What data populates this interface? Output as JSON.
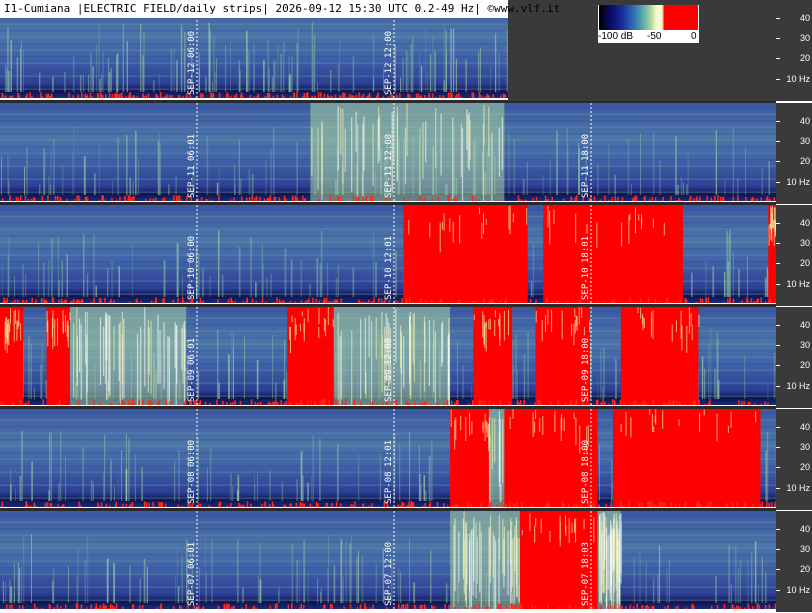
{
  "header": {
    "title": "I1-Cumiana |ELECTRIC FIELD/daily strips| 2026-09-12 15:30 UTC 0.2-49 Hz| ©www.vlf.it"
  },
  "scale": {
    "labels": [
      "-100 dB",
      "-50",
      "0"
    ]
  },
  "axis_labels": [
    "40",
    "30",
    "20",
    "10 Hz"
  ],
  "strips": [
    {
      "name": "sep-12",
      "red": [],
      "bright": [],
      "times": [
        {
          "date": "SEP-12",
          "time": "06:00"
        },
        {
          "date": "SEP-12",
          "time": "12:00"
        }
      ]
    },
    {
      "name": "sep-11",
      "red": [],
      "bright": [
        [
          0.4,
          0.65
        ]
      ],
      "times": [
        {
          "date": "SEP-11",
          "time": "06:01"
        },
        {
          "date": "SEP-11",
          "time": "12:00"
        },
        {
          "date": "SEP-11",
          "time": "18:00"
        }
      ]
    },
    {
      "name": "sep-10",
      "red": [
        [
          0.52,
          0.68
        ],
        [
          0.7,
          0.88
        ],
        [
          0.99,
          1.0
        ]
      ],
      "bright": [
        [
          0.55,
          0.67
        ]
      ],
      "times": [
        {
          "date": "SEP-10",
          "time": "06:00"
        },
        {
          "date": "SEP-10",
          "time": "12:01"
        },
        {
          "date": "SEP-10",
          "time": "18:01"
        }
      ]
    },
    {
      "name": "sep-09",
      "red": [
        [
          0.0,
          0.03
        ],
        [
          0.06,
          0.09
        ],
        [
          0.37,
          0.43
        ],
        [
          0.61,
          0.66
        ],
        [
          0.69,
          0.76
        ],
        [
          0.8,
          0.9
        ]
      ],
      "bright": [
        [
          0.09,
          0.24
        ],
        [
          0.43,
          0.58
        ]
      ],
      "times": [
        {
          "date": "SEP-09",
          "time": "06:01"
        },
        {
          "date": "SEP-09",
          "time": "12:00"
        },
        {
          "date": "SEP-09",
          "time": "18:00"
        }
      ]
    },
    {
      "name": "sep-08",
      "red": [
        [
          0.58,
          0.63
        ],
        [
          0.65,
          0.77
        ],
        [
          0.79,
          0.98
        ]
      ],
      "bright": [
        [
          0.62,
          0.75
        ]
      ],
      "times": [
        {
          "date": "SEP-08",
          "time": "06:00"
        },
        {
          "date": "SEP-08",
          "time": "12:01"
        },
        {
          "date": "SEP-08",
          "time": "18:00"
        }
      ]
    },
    {
      "name": "sep-07",
      "red": [
        [
          0.67,
          0.77
        ]
      ],
      "bright": [
        [
          0.58,
          0.67
        ],
        [
          0.77,
          0.8
        ]
      ],
      "times": [
        {
          "date": "SEP-07",
          "time": "06:01"
        },
        {
          "date": "SEP-07",
          "time": "12:00"
        },
        {
          "date": "SEP-07",
          "time": "18:03"
        }
      ]
    }
  ]
}
